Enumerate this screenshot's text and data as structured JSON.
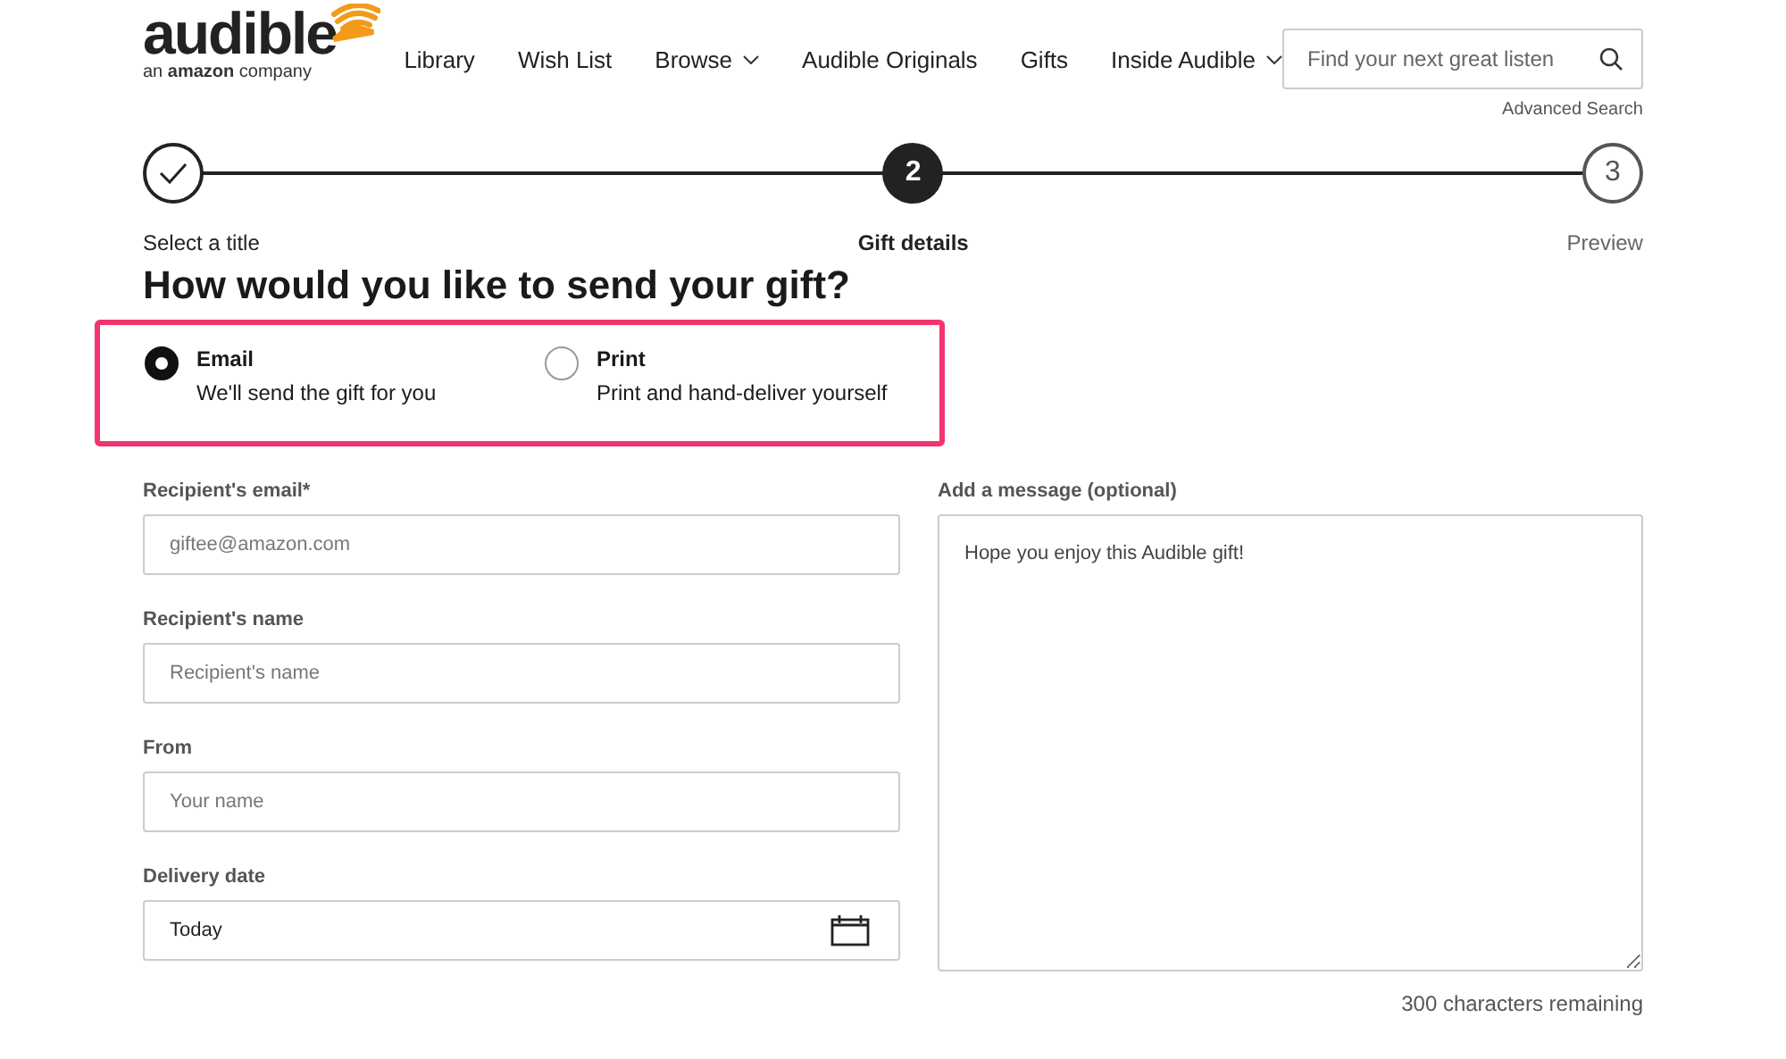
{
  "logo": {
    "wordmark": "audible",
    "tagline": "an **amazon** company"
  },
  "nav": [
    {
      "label": "Library",
      "dropdown": false
    },
    {
      "label": "Wish List",
      "dropdown": false
    },
    {
      "label": "Browse",
      "dropdown": true
    },
    {
      "label": "Audible Originals",
      "dropdown": false
    },
    {
      "label": "Gifts",
      "dropdown": false
    },
    {
      "label": "Inside Audible",
      "dropdown": true
    }
  ],
  "search": {
    "placeholder": "Find your next great listen",
    "advanced_link": "Advanced Search"
  },
  "steps": [
    {
      "label": "Select a title",
      "completed": true,
      "selected": false
    },
    {
      "mark": "2",
      "label": "Gift details",
      "completed": false,
      "selected": true
    },
    {
      "mark": "3",
      "label": "Preview",
      "completed": false,
      "selected": false
    }
  ],
  "heading": "How would you like to send your gift?",
  "send_options": [
    {
      "title": "Email",
      "description": "We'll send the gift for you",
      "selected": true
    },
    {
      "title": "Print",
      "description": "Print and hand-deliver yourself",
      "selected": false
    }
  ],
  "fields": [
    {
      "label": "Recipient's email*",
      "placeholder": "giftee@amazon.com",
      "kind": "text"
    },
    {
      "label": "Recipient's name",
      "placeholder": "Recipient's name",
      "kind": "text"
    },
    {
      "label": "From",
      "placeholder": "Your name",
      "kind": "text"
    },
    {
      "label": "Delivery date",
      "value": "Today",
      "kind": "date"
    }
  ],
  "message": {
    "label": "Add a message (optional)",
    "placeholder": "Hope you enjoy this Audible gift!",
    "counter": "300 characters remaining"
  }
}
